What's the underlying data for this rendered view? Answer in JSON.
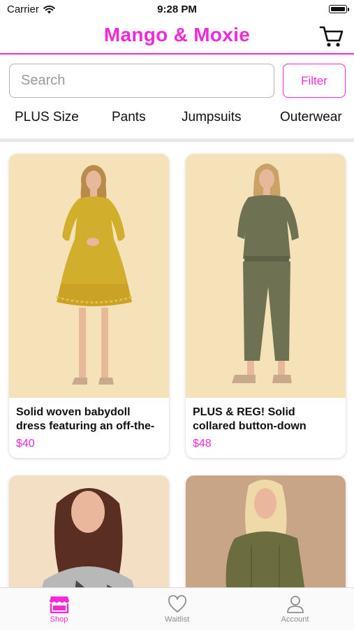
{
  "status_bar": {
    "carrier": "Carrier",
    "time": "9:28 PM",
    "battery_level": 1.0
  },
  "header": {
    "title": "Mango & Moxie",
    "cart_icon": "cart-icon"
  },
  "search": {
    "placeholder": "Search",
    "value": ""
  },
  "filter": {
    "label": "Filter"
  },
  "categories": [
    "PLUS Size",
    "Pants",
    "Jumpsuits",
    "Outerwear"
  ],
  "products": [
    {
      "title_line1": "Solid woven babydoll",
      "title_line2": "dress featuring an off-the-",
      "price": "$40"
    },
    {
      "title_line1": "PLUS & REG! Solid",
      "title_line2": "collared button-down",
      "price": "$48"
    },
    {
      "title_line1": "",
      "title_line2": "",
      "price": ""
    },
    {
      "title_line1": "",
      "title_line2": "",
      "price": ""
    }
  ],
  "tabs": [
    {
      "label": "Shop",
      "icon": "shop-icon",
      "active": true
    },
    {
      "label": "Waitlist",
      "icon": "heart-icon",
      "active": false
    },
    {
      "label": "Account",
      "icon": "account-icon",
      "active": false
    }
  ],
  "colors": {
    "accent": "#f22ad9",
    "tab_inactive": "#8e8e93"
  }
}
